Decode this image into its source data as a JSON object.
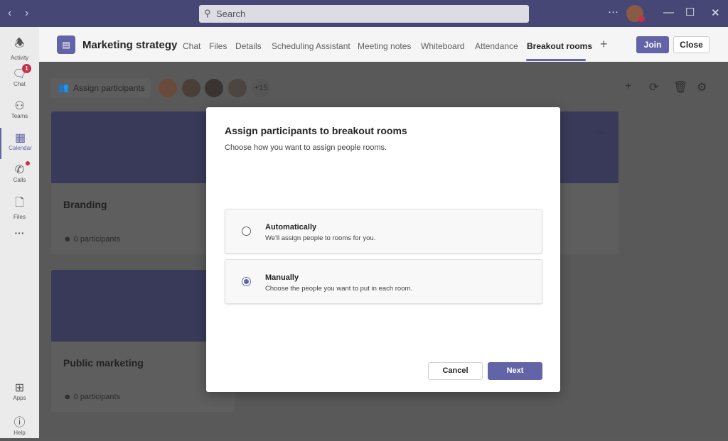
{
  "titlebar": {
    "search_placeholder": "Search",
    "more": "···"
  },
  "sidebar": {
    "items": [
      {
        "label": "Activity",
        "icon": "bell-icon"
      },
      {
        "label": "Chat",
        "icon": "chat-icon",
        "badge": "1"
      },
      {
        "label": "Teams",
        "icon": "teams-icon"
      },
      {
        "label": "Calendar",
        "icon": "calendar-icon"
      },
      {
        "label": "Calls",
        "icon": "phone-icon"
      },
      {
        "label": "Files",
        "icon": "file-icon"
      },
      {
        "label": "Apps",
        "icon": "apps-icon"
      },
      {
        "label": "Help",
        "icon": "help-icon"
      }
    ],
    "more": "···"
  },
  "header": {
    "title": "Marketing strategy",
    "tabs": [
      "Chat",
      "Files",
      "Details",
      "Scheduling Assistant",
      "Meeting notes",
      "Whiteboard",
      "Attendance",
      "Breakout rooms"
    ],
    "active_tab": "Breakout rooms",
    "join": "Join",
    "close": "Close",
    "add": "+"
  },
  "toolbar": {
    "assign": "Assign participants",
    "more_count": "+15"
  },
  "rooms": [
    {
      "name": "Branding",
      "count": "0 participants"
    },
    {
      "name": "Public marketing",
      "count": "0 participants"
    }
  ],
  "dialog": {
    "title": "Assign participants to breakout rooms",
    "subtitle": "Choose how you want to assign people rooms.",
    "options": [
      {
        "label": "Automatically",
        "desc": "We'll assign people to rooms for you.",
        "selected": false
      },
      {
        "label": "Manually",
        "desc": "Choose the people you want to put in each room.",
        "selected": true
      }
    ],
    "cancel": "Cancel",
    "next": "Next"
  },
  "colors": {
    "brand": "#6264a7",
    "titlebar": "#464775",
    "badge": "#c4314b"
  }
}
